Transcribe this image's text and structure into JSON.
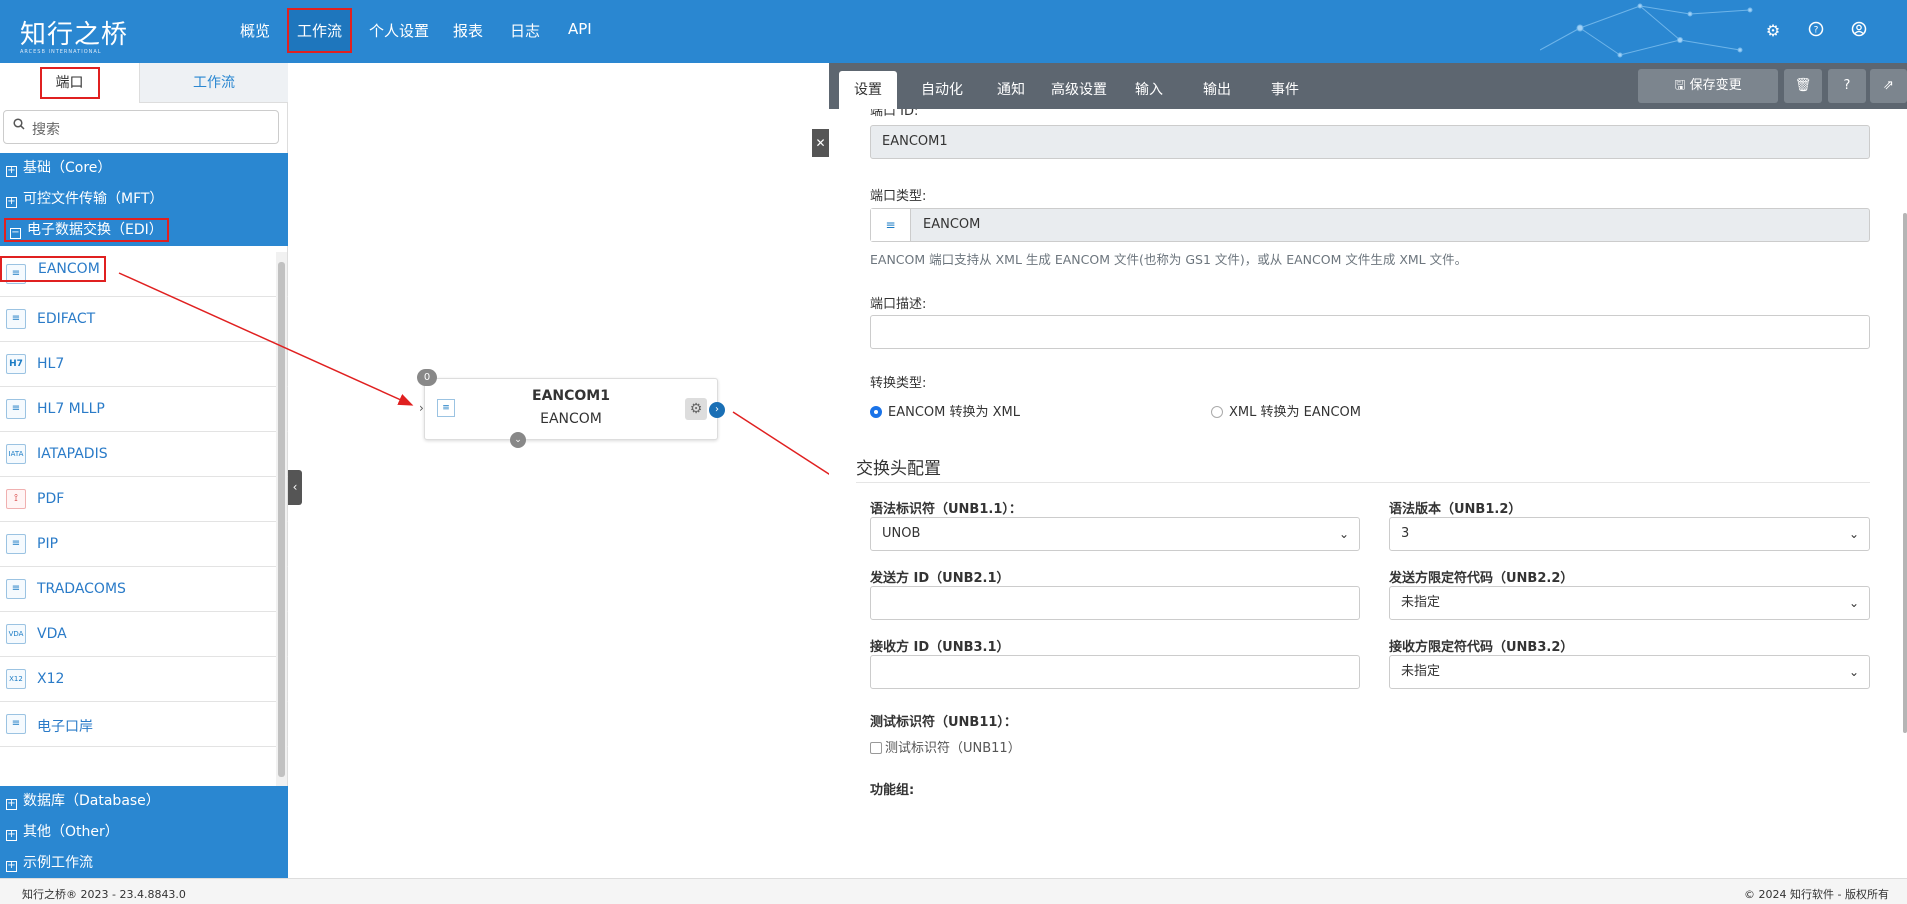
{
  "header": {
    "logo_text": "知行之桥",
    "logo_sub": "ARCESB INTERNATIONAL",
    "nav": [
      "概览",
      "工作流",
      "个人设置",
      "报表",
      "日志",
      "API"
    ],
    "active_nav": "工作流"
  },
  "sidebar": {
    "tabs": [
      "端口",
      "工作流"
    ],
    "search_placeholder": "搜索",
    "categories_top": [
      {
        "label": "基础（Core）",
        "expanded": false
      },
      {
        "label": "可控文件传输（MFT）",
        "expanded": false
      },
      {
        "label": "电子数据交换（EDI）",
        "expanded": true
      }
    ],
    "items": [
      {
        "label": "EANCOM",
        "icon": "eancom-icon"
      },
      {
        "label": "EDIFACT",
        "icon": "edifact-icon"
      },
      {
        "label": "HL7",
        "icon": "hl7-icon"
      },
      {
        "label": "HL7 MLLP",
        "icon": "hl7-mllp-icon"
      },
      {
        "label": "IATAPADIS",
        "icon": "iata-icon"
      },
      {
        "label": "PDF",
        "icon": "pdf-icon"
      },
      {
        "label": "PIP",
        "icon": "pip-icon"
      },
      {
        "label": "TRADACOMS",
        "icon": "tradacoms-icon"
      },
      {
        "label": "VDA",
        "icon": "vda-icon"
      },
      {
        "label": "X12",
        "icon": "x12-icon"
      },
      {
        "label": "电子口岸",
        "icon": "e-port-icon"
      }
    ],
    "categories_bottom": [
      {
        "label": "数据库（Database）",
        "expanded": false
      },
      {
        "label": "其他（Other）",
        "expanded": false
      },
      {
        "label": "示例工作流",
        "expanded": false
      }
    ]
  },
  "canvas": {
    "node": {
      "title": "EANCOM1",
      "subtitle": "EANCOM",
      "badge": "0"
    }
  },
  "panel": {
    "tabs": [
      "设置",
      "自动化",
      "通知",
      "高级设置",
      "输入",
      "输出",
      "事件"
    ],
    "active_tab": "设置",
    "save_label": "保存变更",
    "port_id_label": "端口 ID:",
    "port_id": "EANCOM1",
    "port_type_label": "端口类型:",
    "port_type": "EANCOM",
    "port_type_help": "EANCOM 端口支持从 XML 生成 EANCOM 文件(也称为 GS1 文件)，或从 EANCOM 文件生成 XML 文件。",
    "port_desc_label": "端口描述:",
    "port_desc": "",
    "conv_label": "转换类型:",
    "conv_options": [
      "EANCOM 转换为 XML",
      "XML 转换为 EANCOM"
    ],
    "conv_selected": "EANCOM 转换为 XML",
    "section_title": "交换头配置",
    "syntax_id_label": "语法标识符（UNB1.1）：",
    "syntax_id": "UNOB",
    "syntax_ver_label": "语法版本（UNB1.2）",
    "syntax_ver": "3",
    "sender_id_label": "发送方 ID（UNB2.1）",
    "sender_id": "",
    "sender_q_label": "发送方限定符代码（UNB2.2）",
    "sender_q": "未指定",
    "receiver_id_label": "接收方 ID（UNB3.1）",
    "receiver_id": "",
    "receiver_q_label": "接收方限定符代码（UNB3.2）",
    "receiver_q": "未指定",
    "test_label": "测试标识符（UNB11）：",
    "test_checkbox": "测试标识符（UNB11）",
    "test_checked": false,
    "func_group_label": "功能组:"
  },
  "footer": {
    "left": "知行之桥® 2023 - 23.4.8843.0",
    "right": "© 2024 知行软件 - 版权所有"
  },
  "colors": {
    "brand": "#2a87d1",
    "annotation": "#e02020"
  }
}
